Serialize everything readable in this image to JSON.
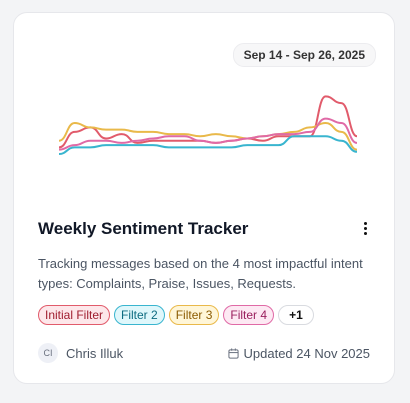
{
  "card": {
    "date_range": "Sep 14 - Sep 26, 2025",
    "title": "Weekly Sentiment Tracker",
    "description": "Tracking messages based on the 4 most impactful intent types: Complaints, Praise, Issues, Requests.",
    "tags": [
      {
        "label": "Initial Filter",
        "color": "#e15b6b"
      },
      {
        "label": "Filter 2",
        "color": "#39b5cf"
      },
      {
        "label": "Filter 3",
        "color": "#e9b94a"
      },
      {
        "label": "Filter 4",
        "color": "#e06aa6"
      }
    ],
    "more_tags": "+1",
    "author": {
      "initials": "CI",
      "name": "Chris Illuk"
    },
    "updated": "Updated 24 Nov 2025"
  },
  "sparkline": {
    "series": [
      {
        "color": "#e15b6b",
        "values": [
          3,
          10,
          12,
          7,
          9,
          5,
          6,
          6,
          6,
          6,
          5,
          6,
          7,
          6,
          8,
          8,
          8,
          26,
          23,
          8
        ]
      },
      {
        "color": "#39b5cf",
        "values": [
          0,
          3,
          3,
          4,
          4,
          4,
          4,
          3,
          3,
          3,
          3,
          3,
          4,
          4,
          4,
          8,
          8,
          8,
          6,
          1
        ]
      },
      {
        "color": "#e9b94a",
        "values": [
          6,
          14,
          12,
          11,
          11,
          10,
          10,
          9,
          9,
          8,
          9,
          8,
          7,
          8,
          9,
          10,
          12,
          14,
          10,
          2
        ]
      },
      {
        "color": "#e06aa6",
        "values": [
          2,
          4,
          6,
          6,
          5,
          6,
          7,
          8,
          8,
          6,
          5,
          6,
          7,
          8,
          9,
          9,
          10,
          16,
          14,
          5
        ]
      }
    ]
  }
}
